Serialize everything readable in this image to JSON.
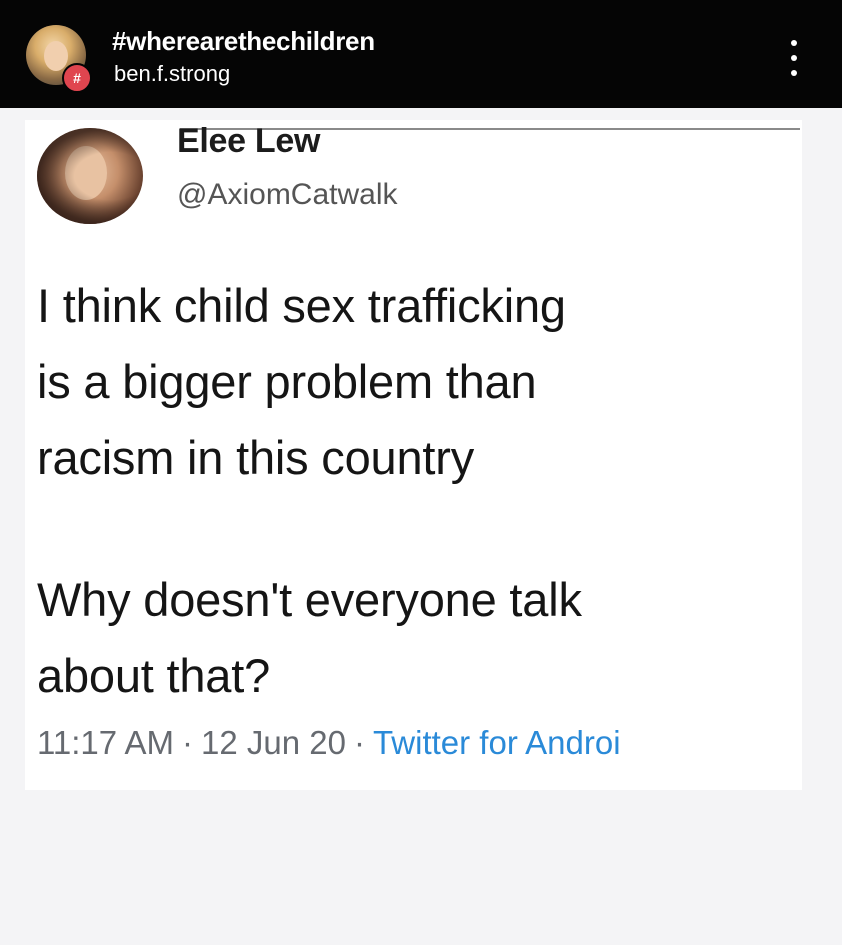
{
  "story_header": {
    "hashtag": "#wherearethechildren",
    "username": "ben.f.strong",
    "badge_symbol": "#",
    "more_icon": "more-vertical-icon"
  },
  "tweet": {
    "display_name": "Elee Lew",
    "handle": "@AxiomCatwalk",
    "paragraph_1": "I think child sex trafficking\nis a bigger problem than\nracism in this country",
    "paragraph_2": "Why doesn't everyone talk\nabout that?",
    "time": "11:17 AM",
    "date": "12 Jun 20",
    "separator": "·",
    "source": "Twitter for Androi"
  },
  "colors": {
    "header_bg": "#050505",
    "badge": "#e0454f",
    "link": "#2a8ad8",
    "page_bg": "#f4f4f6"
  }
}
